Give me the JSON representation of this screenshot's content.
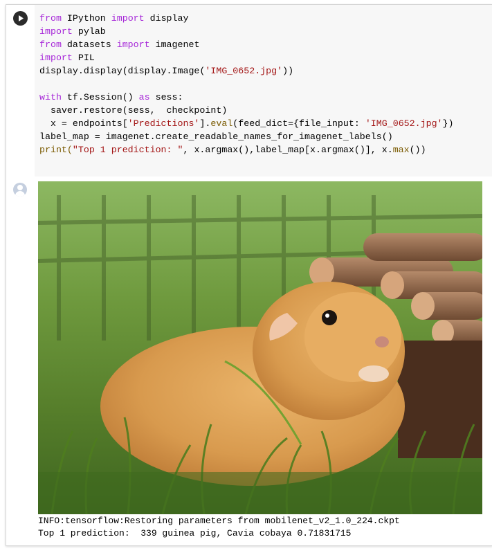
{
  "cell": {
    "run_icon": "play-circle-icon",
    "code_lines": [
      [
        {
          "t": "from",
          "c": "kw"
        },
        {
          "t": " IPython "
        },
        {
          "t": "import",
          "c": "kw"
        },
        {
          "t": " display"
        }
      ],
      [
        {
          "t": "import",
          "c": "kw"
        },
        {
          "t": " pylab"
        }
      ],
      [
        {
          "t": "from",
          "c": "kw"
        },
        {
          "t": " datasets "
        },
        {
          "t": "import",
          "c": "kw"
        },
        {
          "t": " imagenet"
        }
      ],
      [
        {
          "t": "import",
          "c": "kw"
        },
        {
          "t": " PIL"
        }
      ],
      [
        {
          "t": "display.display(display.Image("
        },
        {
          "t": "'IMG_0652.jpg'",
          "c": "str"
        },
        {
          "t": "))"
        }
      ],
      [
        {
          "t": ""
        }
      ],
      [
        {
          "t": "with",
          "c": "kw"
        },
        {
          "t": " tf.Session() "
        },
        {
          "t": "as",
          "c": "kw"
        },
        {
          "t": " sess:"
        }
      ],
      [
        {
          "t": "  saver.restore(sess,  checkpoint)"
        }
      ],
      [
        {
          "t": "  x = endpoints["
        },
        {
          "t": "'Predictions'",
          "c": "str"
        },
        {
          "t": "]."
        },
        {
          "t": "eval",
          "c": "fn"
        },
        {
          "t": "(feed_dict={file_input: "
        },
        {
          "t": "'IMG_0652.jpg'",
          "c": "str"
        },
        {
          "t": "})"
        }
      ],
      [
        {
          "t": "label_map = imagenet.create_readable_names_for_imagenet_labels()"
        }
      ],
      [
        {
          "t": "print",
          "c": "fn"
        },
        {
          "t": "(",
          "c": "fn"
        },
        {
          "t": "\"Top 1 prediction: \"",
          "c": "str"
        },
        {
          "t": ", x.argmax(),label_map[x.argmax()], x."
        },
        {
          "t": "max",
          "c": "fn"
        },
        {
          "t": "())"
        }
      ]
    ]
  },
  "output": {
    "output_icon": "user-avatar-icon",
    "image_subject": "guinea pig in grass beside log pile",
    "log_line": "INFO:tensorflow:Restoring parameters from mobilenet_v2_1.0_224.ckpt",
    "prediction_line": "Top 1 prediction:  339 guinea pig, Cavia cobaya 0.71831715"
  }
}
